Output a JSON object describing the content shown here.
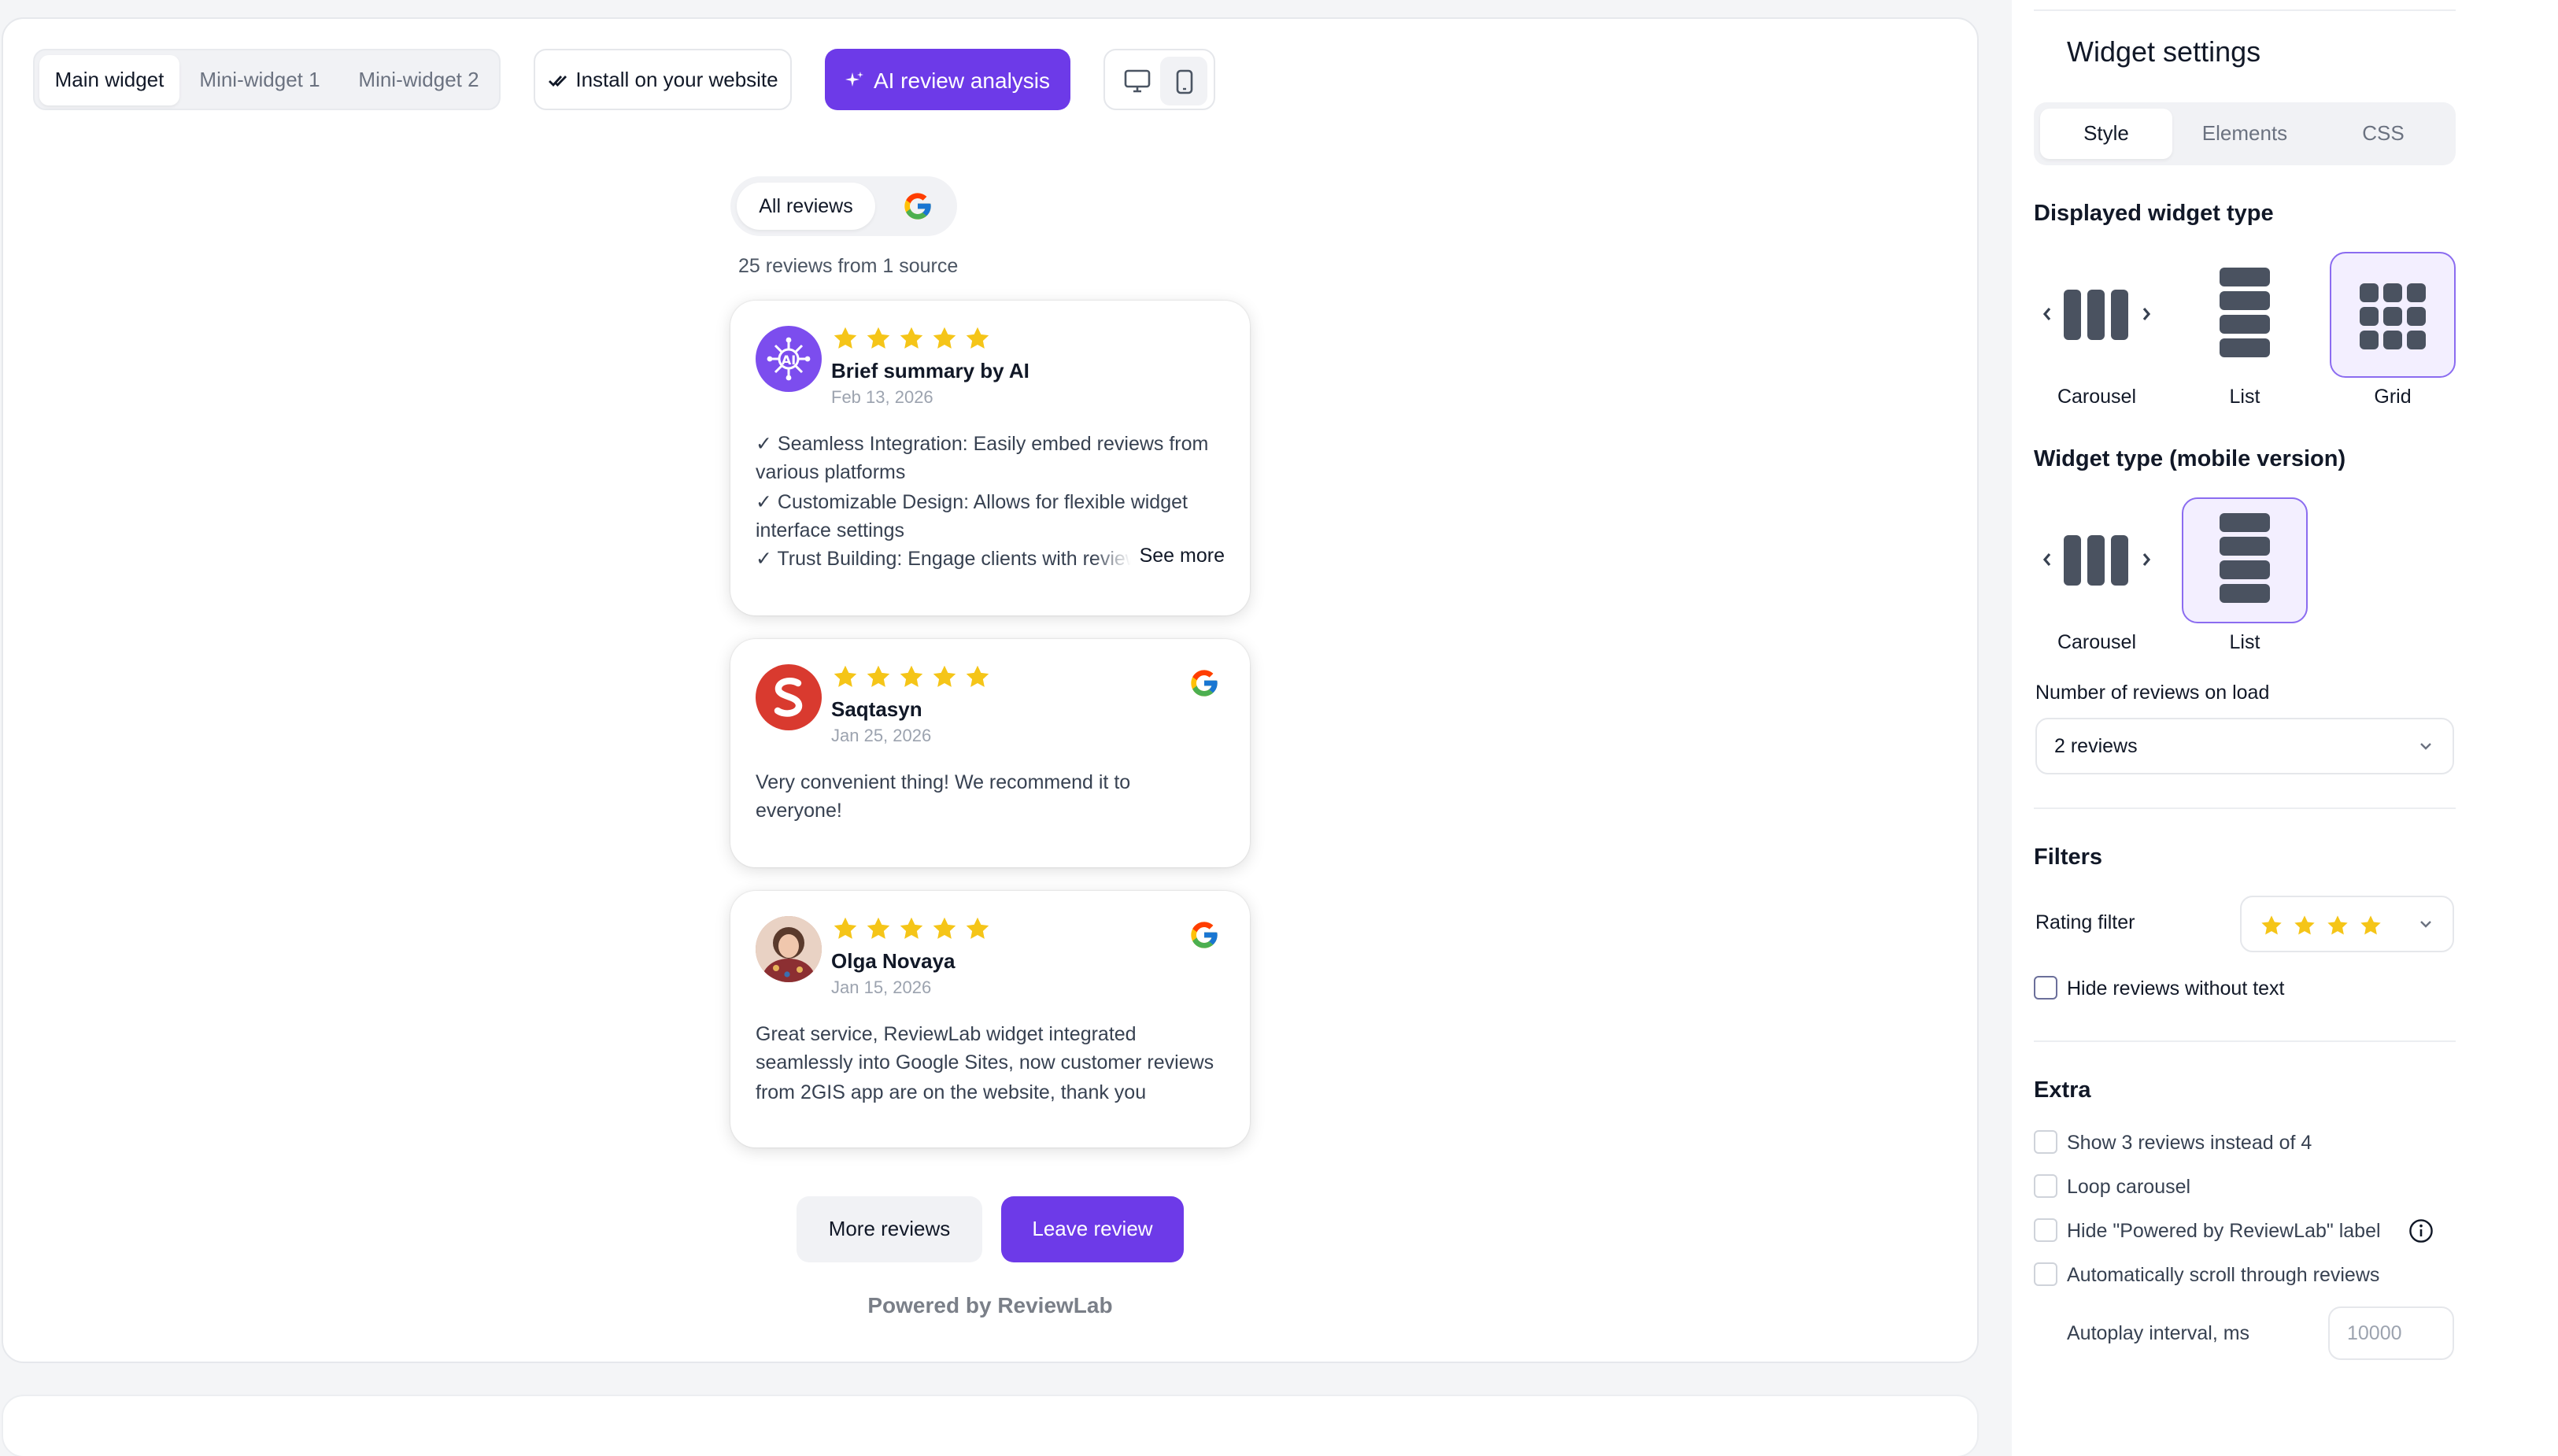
{
  "toolbar": {
    "tabs": [
      "Main widget",
      "Mini-widget 1",
      "Mini-widget 2"
    ],
    "install_label": "Install on your website",
    "ai_label": "AI review analysis",
    "device_icons": [
      "desktop-icon",
      "mobile-icon"
    ]
  },
  "preview": {
    "source_all": "All reviews",
    "count_text": "25 reviews from 1 source",
    "ai_card": {
      "author": "Brief summary by AI",
      "date": "Feb 13, 2026",
      "lines": [
        "✓ Seamless Integration: Easily embed reviews from",
        "various platforms",
        "✓ Customizable Design: Allows for flexible widget",
        "interface settings",
        "✓ Trust Building: Engage clients with reviews"
      ],
      "see_more": "See more",
      "rating": 5
    },
    "reviews": [
      {
        "author": "Saqtasyn",
        "date": "Jan 25, 2026",
        "text": "Very convenient thing! We recommend it to everyone!",
        "rating": 5,
        "source_icon": "google-icon"
      },
      {
        "author": "Olga Novaya",
        "date": "Jan 15, 2026",
        "text": "Great service, ReviewLab widget integrated seamlessly into Google Sites, now customer reviews from 2GIS app are on the website, thank you",
        "rating": 5,
        "source_icon": "google-icon"
      }
    ],
    "more_reviews_label": "More reviews",
    "leave_review_label": "Leave review",
    "powered_by": "Powered by ReviewLab"
  },
  "settings": {
    "title": "Widget settings",
    "tabs": [
      "Style",
      "Elements",
      "CSS"
    ],
    "displayed_type_heading": "Displayed widget type",
    "displayed_types": [
      "Carousel",
      "List",
      "Grid"
    ],
    "displayed_selected": "Grid",
    "mobile_type_heading": "Widget type (mobile version)",
    "mobile_types": [
      "Carousel",
      "List"
    ],
    "mobile_selected": "List",
    "reviews_on_load_label": "Number of reviews on load",
    "reviews_on_load_value": "2 reviews",
    "filters_heading": "Filters",
    "rating_filter_label": "Rating filter",
    "rating_filter_stars": 4,
    "hide_without_text_label": "Hide reviews without text",
    "hide_without_text_checked": false,
    "extra_heading": "Extra",
    "extra_options": [
      {
        "label": "Show 3 reviews instead of 4",
        "checked": false
      },
      {
        "label": "Loop carousel",
        "checked": false
      },
      {
        "label": "Hide \"Powered by ReviewLab\" label",
        "checked": false
      },
      {
        "label": "Automatically scroll through reviews",
        "checked": false
      }
    ],
    "autoplay_label": "Autoplay interval, ms",
    "autoplay_placeholder": "10000"
  },
  "colors": {
    "accent": "#6d3ae8",
    "star": "#f5c518",
    "review_avatar_red": "#d93a2f"
  }
}
